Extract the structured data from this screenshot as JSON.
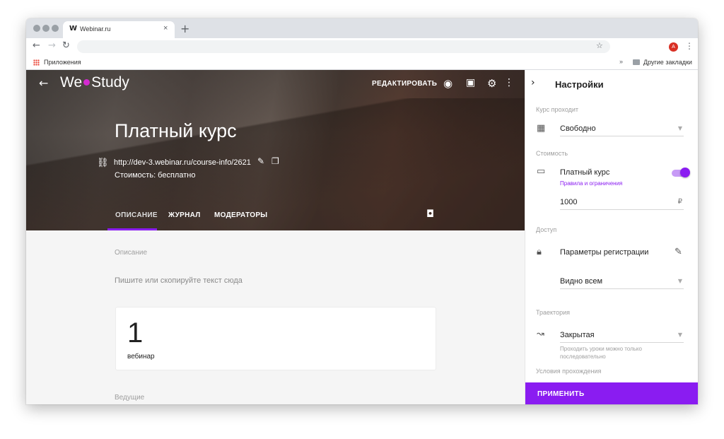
{
  "browser": {
    "tab_title": "Webinar.ru",
    "tab_favicon": "W",
    "tab_close": "×",
    "new_tab": "+",
    "profile_initial": "A",
    "bookmarks": {
      "apps_label": "Приложения",
      "more": "»",
      "other_label": "Другие закладки"
    }
  },
  "header": {
    "logo_part1": "We",
    "logo_part2": "Study",
    "logo_dot_color": "#d42ad0",
    "edit_label": "РЕДАКТИРОВАТЬ",
    "icons": [
      "arrow-left-icon",
      "eye-icon",
      "clipboard-check-icon",
      "gear-icon",
      "more-vert-icon"
    ]
  },
  "course": {
    "title": "Платный курс",
    "url": "http://dev-3.webinar.ru/course-info/2621",
    "price": "Стоимость: бесплатно"
  },
  "tabs": [
    {
      "label": "ОПИСАНИЕ",
      "active": true
    },
    {
      "label": "ЖУРНАЛ",
      "active": false
    },
    {
      "label": "МОДЕРАТОРЫ",
      "active": false
    }
  ],
  "description": {
    "label": "Описание",
    "placeholder": "Пишите или скопируйте текст сюда",
    "card_count": "1",
    "card_label": "вебинар",
    "hosts_label": "Ведущие"
  },
  "settings": {
    "title": "Настройки",
    "schedule_section": "Курс проходит",
    "schedule_value": "Свободно",
    "cost_section": "Стоимость",
    "paid_label": "Платный курс",
    "paid_enabled": true,
    "rules_link": "Правила и ограничения",
    "price_value": "1000",
    "currency": "₽",
    "access_section": "Доступ",
    "registration_label": "Параметры регистрации",
    "visibility_value": "Видно всем",
    "trajectory_section": "Траектория",
    "trajectory_value": "Закрытая",
    "trajectory_hint": "Проходить уроки можно только последовательно",
    "conditions_section": "Условия прохождения",
    "apply_label": "ПРИМЕНИТЬ",
    "accent_color": "#8a1cf1"
  }
}
